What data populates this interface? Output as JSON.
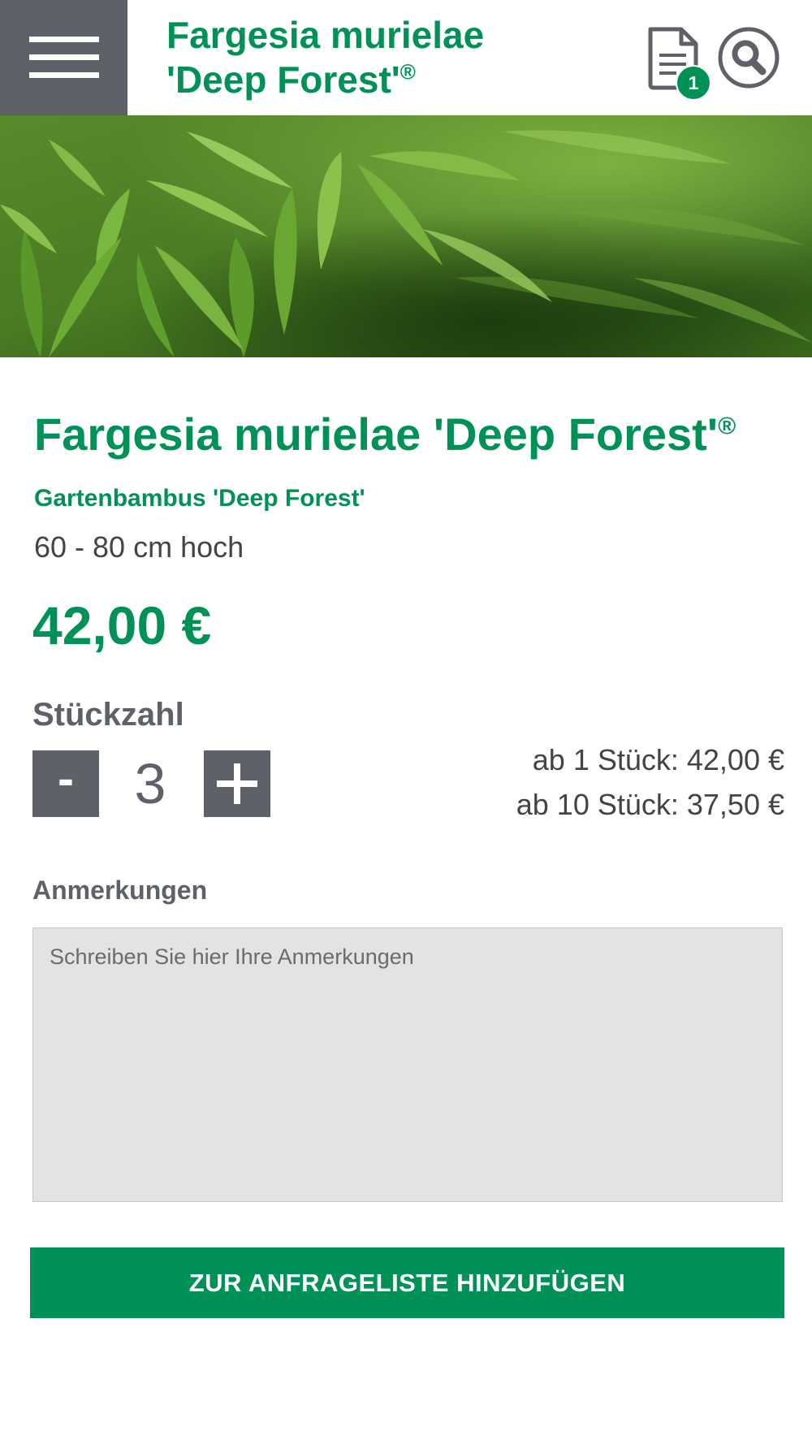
{
  "header": {
    "title_line1": "Fargesia murielae",
    "title_line2": "'Deep Forest'",
    "title_reg": "®",
    "menu_icon": "hamburger-menu-icon",
    "inquiry_list_icon": "document-icon",
    "inquiry_count": "1",
    "search_icon": "search-icon"
  },
  "hero": {
    "image": "bamboo-leaves-photo"
  },
  "product": {
    "title": "Fargesia murielae 'Deep Forest'",
    "title_reg": "®",
    "subtitle": "Gartenbambus 'Deep Forest'",
    "height": "60 - 80 cm hoch",
    "price": "42,00 €"
  },
  "quantity": {
    "label": "Stückzahl",
    "minus_label": "-",
    "value": "3",
    "plus_icon": "plus-icon"
  },
  "price_tiers": [
    "ab 1 Stück: 42,00 €",
    "ab 10 Stück: 37,50 €"
  ],
  "notes": {
    "label": "Anmerkungen",
    "placeholder": "Schreiben Sie hier Ihre Anmerkungen"
  },
  "actions": {
    "add_to_list_label": "ZUR ANFRAGELISTE HINZUFÜGEN"
  },
  "colors": {
    "brand_green": "#009156",
    "dark_gray": "#5f6168",
    "field_gray": "#e3e3e3"
  }
}
